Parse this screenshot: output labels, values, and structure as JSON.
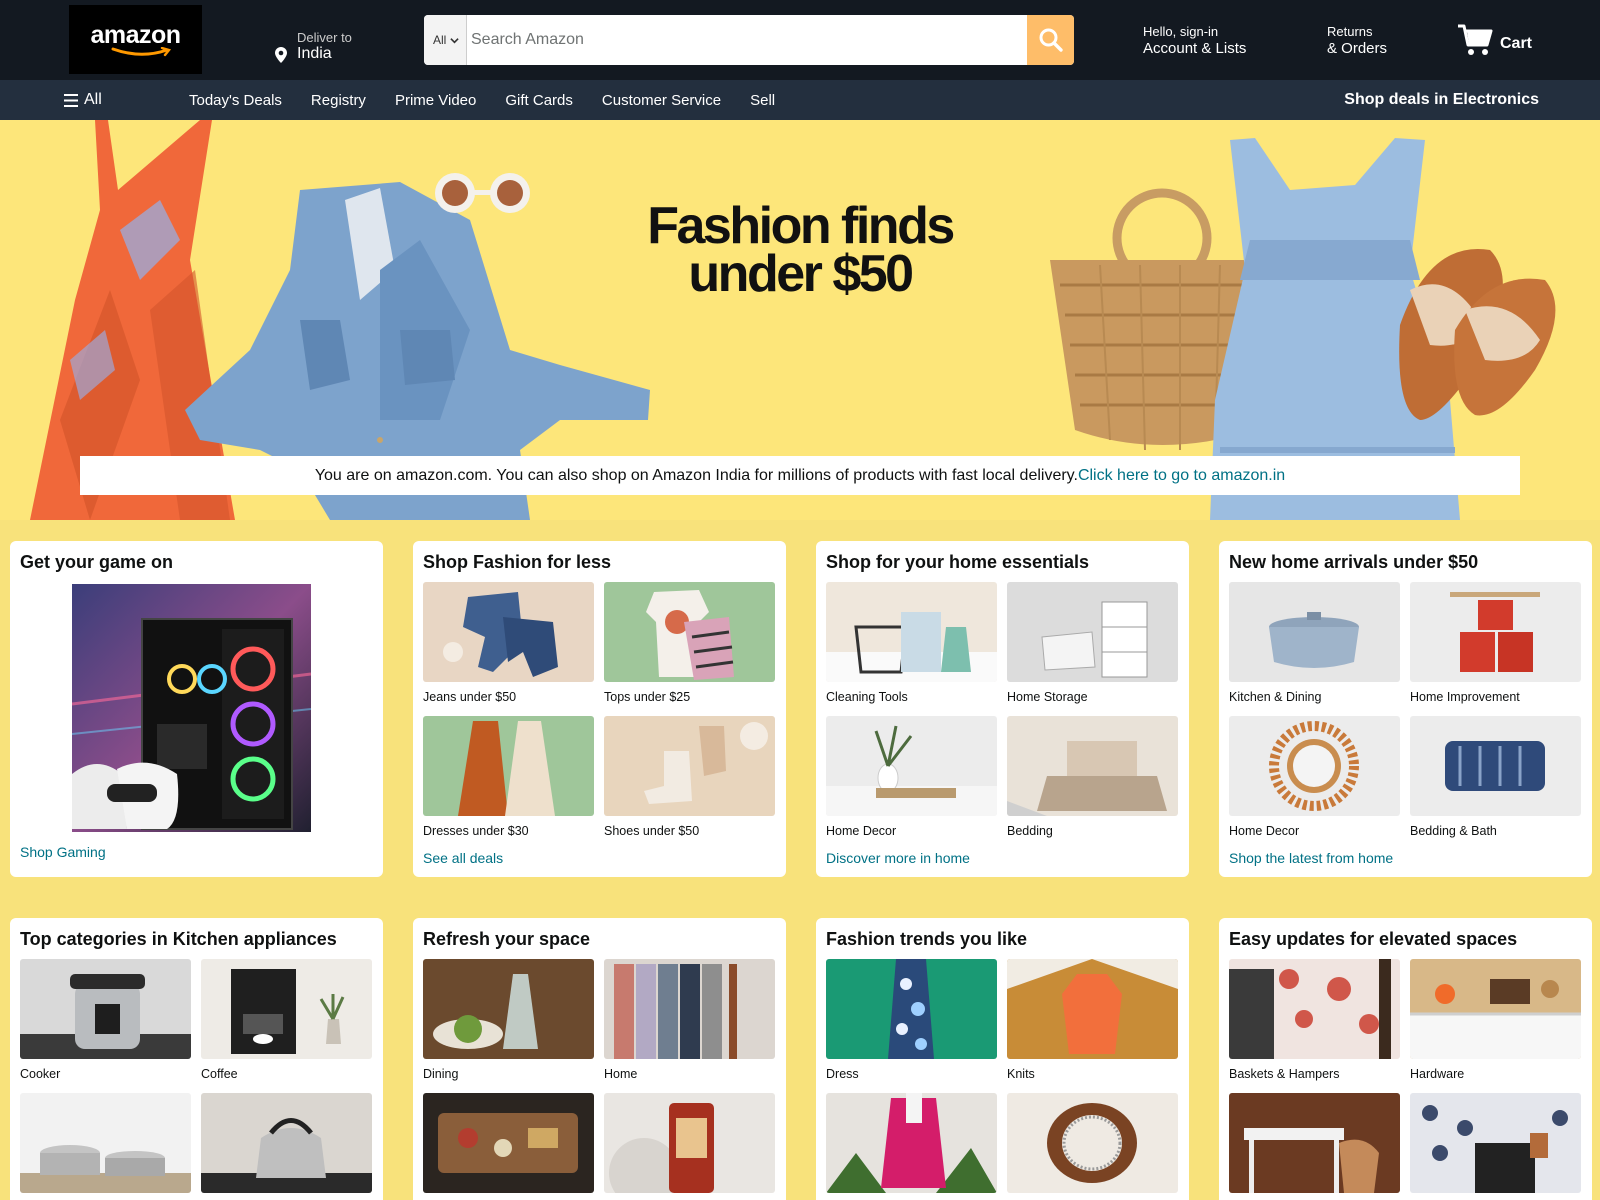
{
  "header": {
    "logo_text": "amazon",
    "deliver_label": "Deliver to",
    "deliver_location": "India",
    "search": {
      "category": "All",
      "placeholder": "Search Amazon"
    },
    "account_greeting": "Hello, sign-in",
    "account_label": "Account & Lists",
    "returns_label": "Returns",
    "orders_label": "& Orders",
    "cart_label": "Cart"
  },
  "subnav": {
    "all_label": "All",
    "links": [
      "Today's Deals",
      "Registry",
      "Prime Video",
      "Gift Cards",
      "Customer Service",
      "Sell"
    ],
    "promo": "Shop deals in Electronics"
  },
  "hero": {
    "headline_line1": "Fashion finds",
    "headline_line2": "under $50",
    "notice_text": "You are on amazon.com. You can also shop on Amazon India for millions of products with fast local delivery.",
    "notice_link": "Click here to go to amazon.in"
  },
  "cards": [
    {
      "title": "Get your game on",
      "link": "Shop Gaming",
      "items": []
    },
    {
      "title": "Shop Fashion for less",
      "link": "See all deals",
      "items": [
        "Jeans under $50",
        "Tops under $25",
        "Dresses under $30",
        "Shoes under $50"
      ]
    },
    {
      "title": "Shop for your home essentials",
      "link": "Discover more in home",
      "items": [
        "Cleaning Tools",
        "Home Storage",
        "Home Decor",
        "Bedding"
      ]
    },
    {
      "title": "New home arrivals under $50",
      "link": "Shop the latest from home",
      "items": [
        "Kitchen & Dining",
        "Home Improvement",
        "Home Decor",
        "Bedding & Bath"
      ]
    },
    {
      "title": "Top categories in Kitchen appliances",
      "items": [
        "Cooker",
        "Coffee",
        "",
        ""
      ]
    },
    {
      "title": "Refresh your space",
      "items": [
        "Dining",
        "Home",
        "",
        ""
      ]
    },
    {
      "title": "Fashion trends you like",
      "items": [
        "Dress",
        "Knits",
        "",
        ""
      ]
    },
    {
      "title": "Easy updates for elevated spaces",
      "items": [
        "Baskets & Hampers",
        "Hardware",
        "",
        ""
      ]
    }
  ],
  "colors": {
    "nav_top": "#131921",
    "nav_sub": "#232f3e",
    "search_button": "#febd69",
    "page_bg": "#f8e27b",
    "hero_bg": "#fde67a",
    "link": "#007185"
  },
  "icons": [
    "location-pin-icon",
    "chevron-down-icon",
    "search-icon",
    "cart-icon",
    "menu-icon"
  ]
}
